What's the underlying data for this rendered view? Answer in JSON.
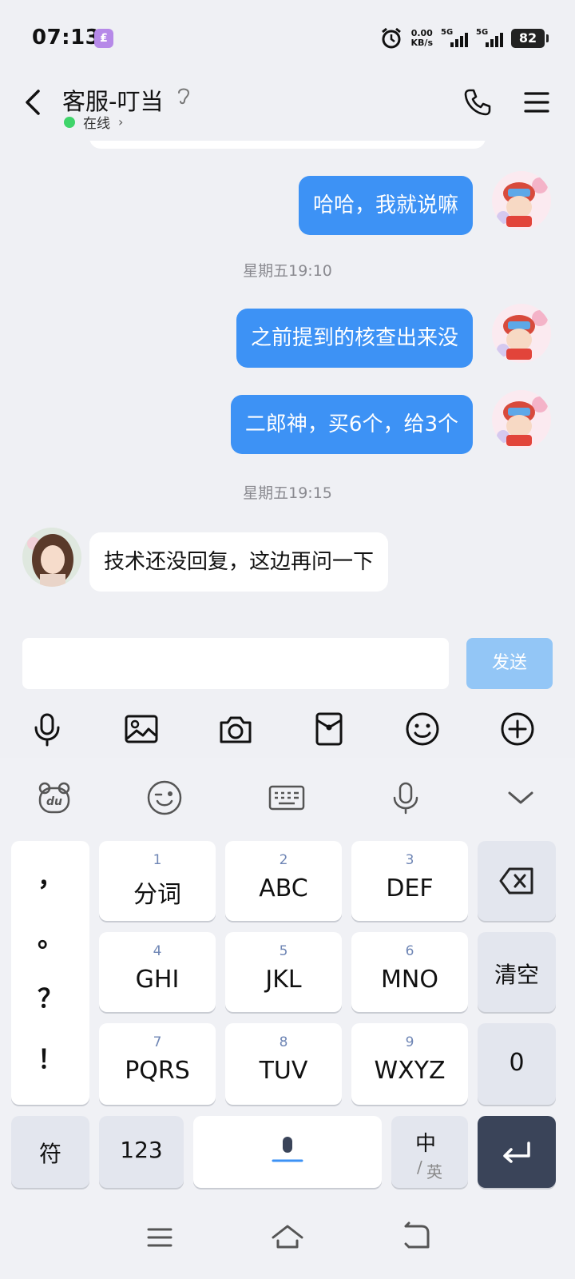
{
  "status_bar": {
    "time": "07:13",
    "app_badge": "$",
    "net_speed_value": "0.00",
    "net_speed_unit": "KB/s",
    "sim1": "5G",
    "sim2": "5G",
    "battery": "82"
  },
  "header": {
    "title": "客服-叮当",
    "presence": "在线"
  },
  "chat": {
    "messages": [
      {
        "from": "me",
        "text": "哈哈，我就说嘛"
      },
      {
        "timestamp": "星期五19:10"
      },
      {
        "from": "me",
        "text": "之前提到的核查出来没"
      },
      {
        "from": "me",
        "text": "二郎神，买6个，给3个"
      },
      {
        "timestamp": "星期五19:15"
      },
      {
        "from": "them",
        "text": "技术还没回复，这边再问一下"
      }
    ]
  },
  "composer": {
    "send_label": "发送",
    "placeholder": ""
  },
  "keyboard": {
    "punctuation": [
      "，",
      "。",
      "？",
      "！"
    ],
    "keys": [
      {
        "num": "1",
        "label": "分词"
      },
      {
        "num": "2",
        "label": "ABC"
      },
      {
        "num": "3",
        "label": "DEF"
      },
      {
        "num": "4",
        "label": "GHI"
      },
      {
        "num": "5",
        "label": "JKL"
      },
      {
        "num": "6",
        "label": "MNO"
      },
      {
        "num": "7",
        "label": "PQRS"
      },
      {
        "num": "8",
        "label": "TUV"
      },
      {
        "num": "9",
        "label": "WXYZ"
      }
    ],
    "clear_label": "清空",
    "zero_label": "0",
    "symbol_label": "符",
    "num_label": "123",
    "lang_main": "中",
    "lang_alt": "英"
  },
  "colors": {
    "accent": "#3d92f5",
    "send_disabled": "#93c6f6",
    "online": "#3fd46a",
    "enter_key": "#3a4459"
  }
}
